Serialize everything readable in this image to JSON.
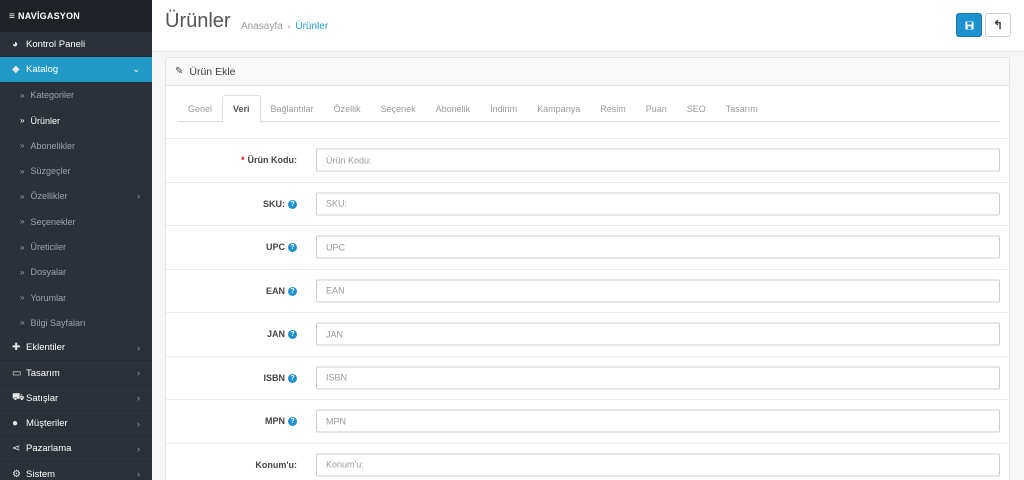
{
  "sidebar": {
    "header": "NAVİGASYON",
    "items": [
      {
        "label": "Kontrol Paneli",
        "icon": "dashboard-icon"
      },
      {
        "label": "Katalog",
        "icon": "tags-icon"
      },
      {
        "label": "Eklentiler",
        "icon": "puzzle-icon"
      },
      {
        "label": "Tasarım",
        "icon": "monitor-icon"
      },
      {
        "label": "Satışlar",
        "icon": "cart-icon"
      },
      {
        "label": "Müşteriler",
        "icon": "user-icon"
      },
      {
        "label": "Pazarlama",
        "icon": "share-icon"
      },
      {
        "label": "Sistem",
        "icon": "gear-icon"
      }
    ],
    "catalog_sub": [
      "Kategoriler",
      "Ürünler",
      "Abonelikler",
      "Süzgeçler",
      "Özellikler",
      "Seçenekler",
      "Üreticiler",
      "Dosyalar",
      "Yorumlar",
      "Bilgi Sayfaları"
    ]
  },
  "header": {
    "title": "Ürünler",
    "breadcrumb": [
      "Anasayfa",
      "Ürünler"
    ]
  },
  "panel": {
    "title": "Ürün Ekle",
    "tabs": [
      "Genel",
      "Veri",
      "Bağlantılar",
      "Özellik",
      "Seçenek",
      "Abonelik",
      "İndirim",
      "Kampanya",
      "Resim",
      "Puan",
      "SEO",
      "Tasarım"
    ],
    "active_tab": "Veri"
  },
  "form": {
    "fields": [
      {
        "label": "Ürün Kodu:",
        "placeholder": "Ürün Kodu:",
        "required": true,
        "help": false
      },
      {
        "label": "SKU:",
        "placeholder": "SKU:",
        "required": false,
        "help": true
      },
      {
        "label": "UPC",
        "placeholder": "UPC",
        "required": false,
        "help": true
      },
      {
        "label": "EAN",
        "placeholder": "EAN",
        "required": false,
        "help": true
      },
      {
        "label": "JAN",
        "placeholder": "JAN",
        "required": false,
        "help": true
      },
      {
        "label": "ISBN",
        "placeholder": "ISBN",
        "required": false,
        "help": true
      },
      {
        "label": "MPN",
        "placeholder": "MPN",
        "required": false,
        "help": true
      },
      {
        "label": "Konum'u:",
        "placeholder": "Konum'u:",
        "required": false,
        "help": false
      }
    ]
  },
  "colors": {
    "sidebar_bg": "#2b3138",
    "accent": "#229ac8",
    "primary_button": "#1e91cf"
  }
}
